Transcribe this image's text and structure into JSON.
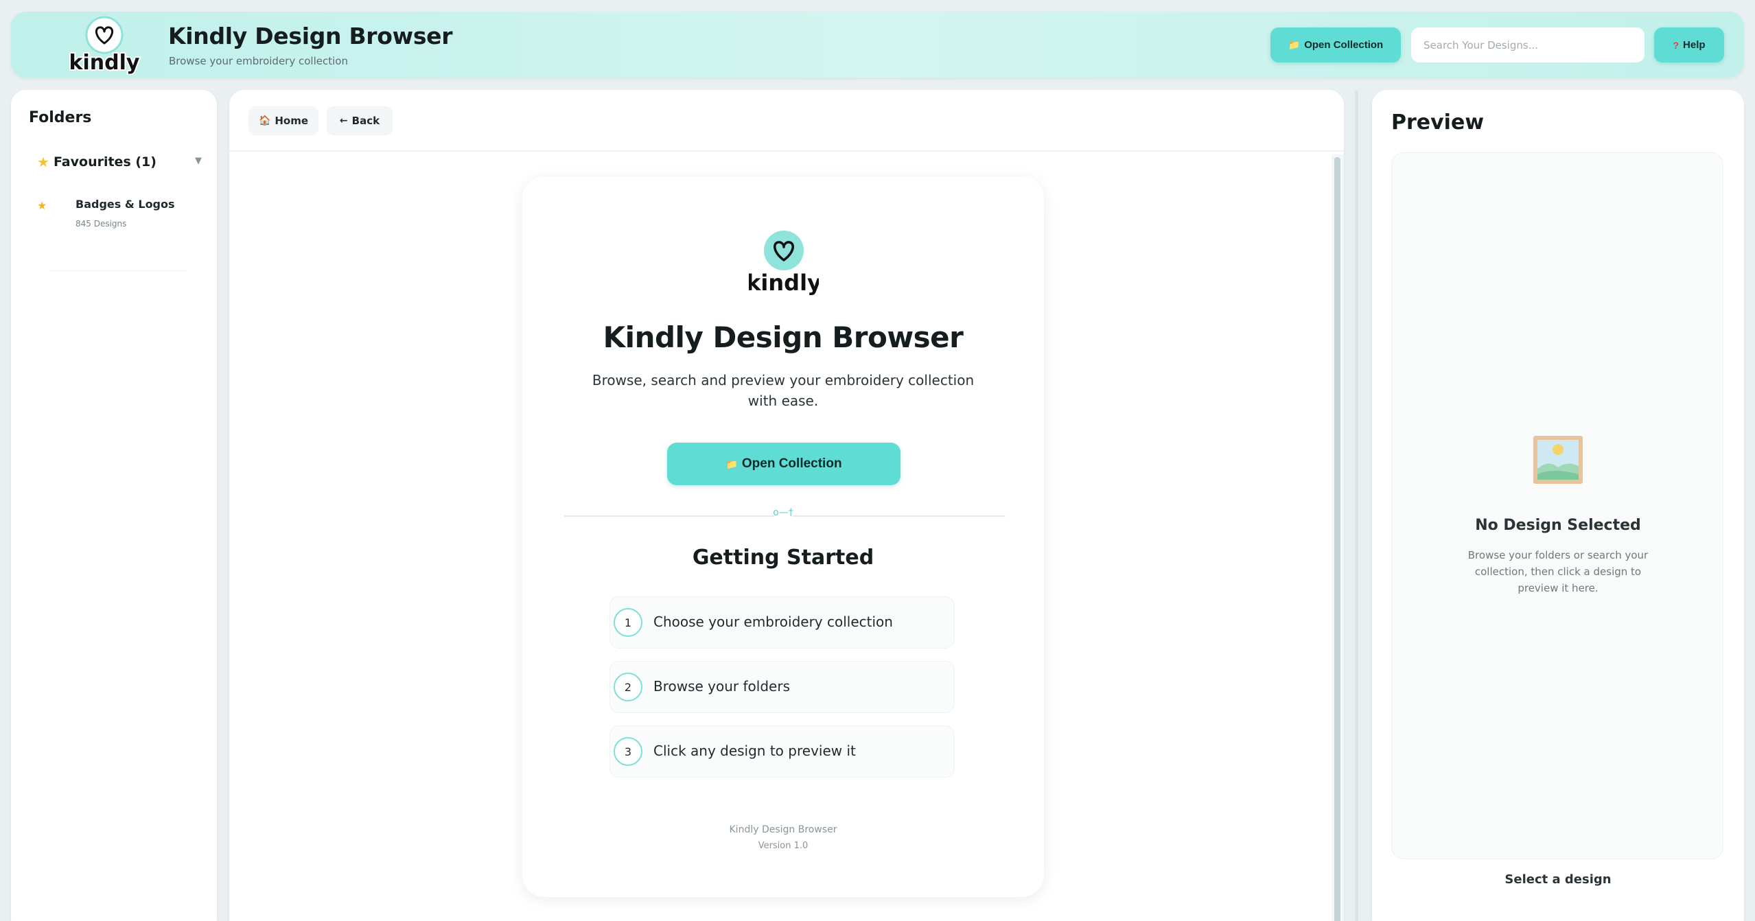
{
  "header": {
    "logo_text": "kindly",
    "title": "Kindly Design Browser",
    "subtitle": "Browse your embroidery collection",
    "open_collection_icon": "folder-icon",
    "open_collection_label": "Open Collection",
    "search_placeholder": "Search Your Designs...",
    "help_icon": "question-icon",
    "help_label": "Help"
  },
  "sidebar": {
    "title": "Folders",
    "favourites_label": "Favourites (1)",
    "favourites_expanded": true,
    "items": [
      {
        "name": "Badges & Logos",
        "count": "845 Designs",
        "starred": true
      }
    ]
  },
  "main": {
    "nav": {
      "home_icon": "house-icon",
      "home_label": "Home",
      "back_icon": "arrow-left-icon",
      "back_label": "Back"
    },
    "welcome": {
      "logo_text": "kindly",
      "title": "Kindly Design Browser",
      "description": "Browse, search and preview your embroidery collection with ease.",
      "open_button_icon": "folder-icon",
      "open_button_label": "Open Collection",
      "divider_icon": "needle-thread-icon",
      "getting_started_title": "Getting Started",
      "steps": [
        {
          "number": "1",
          "text": "Choose your embroidery collection"
        },
        {
          "number": "2",
          "text": "Browse your folders"
        },
        {
          "number": "3",
          "text": "Click any design to preview it"
        }
      ],
      "footer_name": "Kindly Design Browser",
      "footer_version": "Version 1.0"
    }
  },
  "preview": {
    "title": "Preview",
    "empty_icon": "picture-icon",
    "empty_title": "No Design Selected",
    "empty_description": "Browse your folders or search your collection, then click a design to preview it here.",
    "footer_label": "Select a design"
  },
  "colors": {
    "accent": "#5fdcd3",
    "header_bg": "#c6f2ec",
    "star": "#f5c22e",
    "logo_circle": "#8fe3da"
  }
}
